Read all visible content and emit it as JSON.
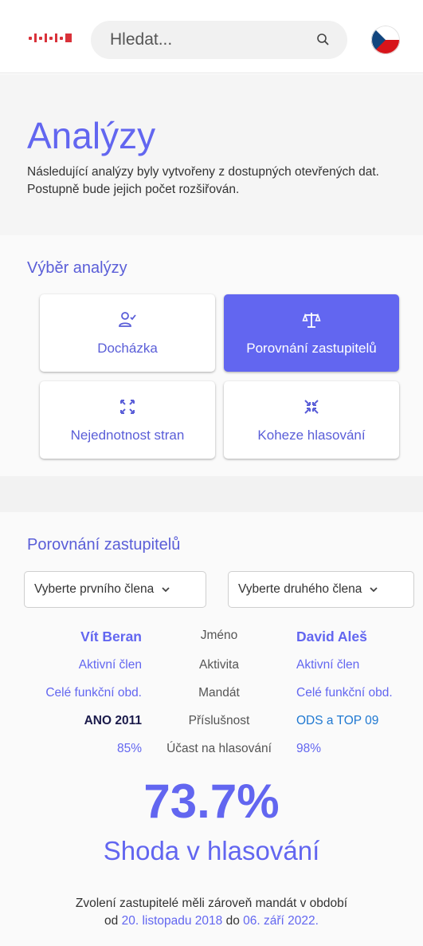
{
  "header": {
    "search_placeholder": "Hledat...",
    "brand_color": "#d9323a"
  },
  "intro": {
    "title": "Analýzy",
    "description": "Následující analýzy byly vytvořeny z dostupných otevřených dat. Postupně bude jejich počet rozšiřován."
  },
  "selection": {
    "title": "Výběr analýzy",
    "cards": [
      {
        "label": "Docházka",
        "icon": "person-check-icon",
        "active": false
      },
      {
        "label": "Porovnání zastupitelů",
        "icon": "scales-icon",
        "active": true
      },
      {
        "label": "Nejednotnost stran",
        "icon": "expand-arrows-icon",
        "active": false
      },
      {
        "label": "Koheze hlasování",
        "icon": "collapse-arrows-icon",
        "active": false
      }
    ]
  },
  "comparison": {
    "title": "Porovnání zastupitelů",
    "first_select": "Vyberte prvního člena",
    "second_select": "Vyberte druhého člena",
    "rows": [
      {
        "left": "Vít Beran",
        "label": "Jméno",
        "right": "David Aleš"
      },
      {
        "left": "Aktivní člen",
        "label": "Aktivita",
        "right": "Aktivní člen"
      },
      {
        "left": "Celé funkční obd.",
        "label": "Mandát",
        "right": "Celé funkční obd."
      },
      {
        "left": "ANO 2011",
        "label": "Příslušnost",
        "right": "ODS a TOP 09"
      },
      {
        "left": "85%",
        "label": "Účast na hlasování",
        "right": "98%"
      }
    ],
    "agreement_value": "73.7%",
    "agreement_label": "Shoda v hlasování",
    "note_line1": "Zvolení zastupitelé měli zároveň mandát v období",
    "note_from_prefix": "od",
    "note_from": "20. listopadu 2018",
    "note_to_prefix": "do",
    "note_to": "06. září 2022."
  },
  "colors": {
    "accent": "#6266f0",
    "party_ano": "#1b1b4b",
    "party_ods": "#1f78d1"
  }
}
